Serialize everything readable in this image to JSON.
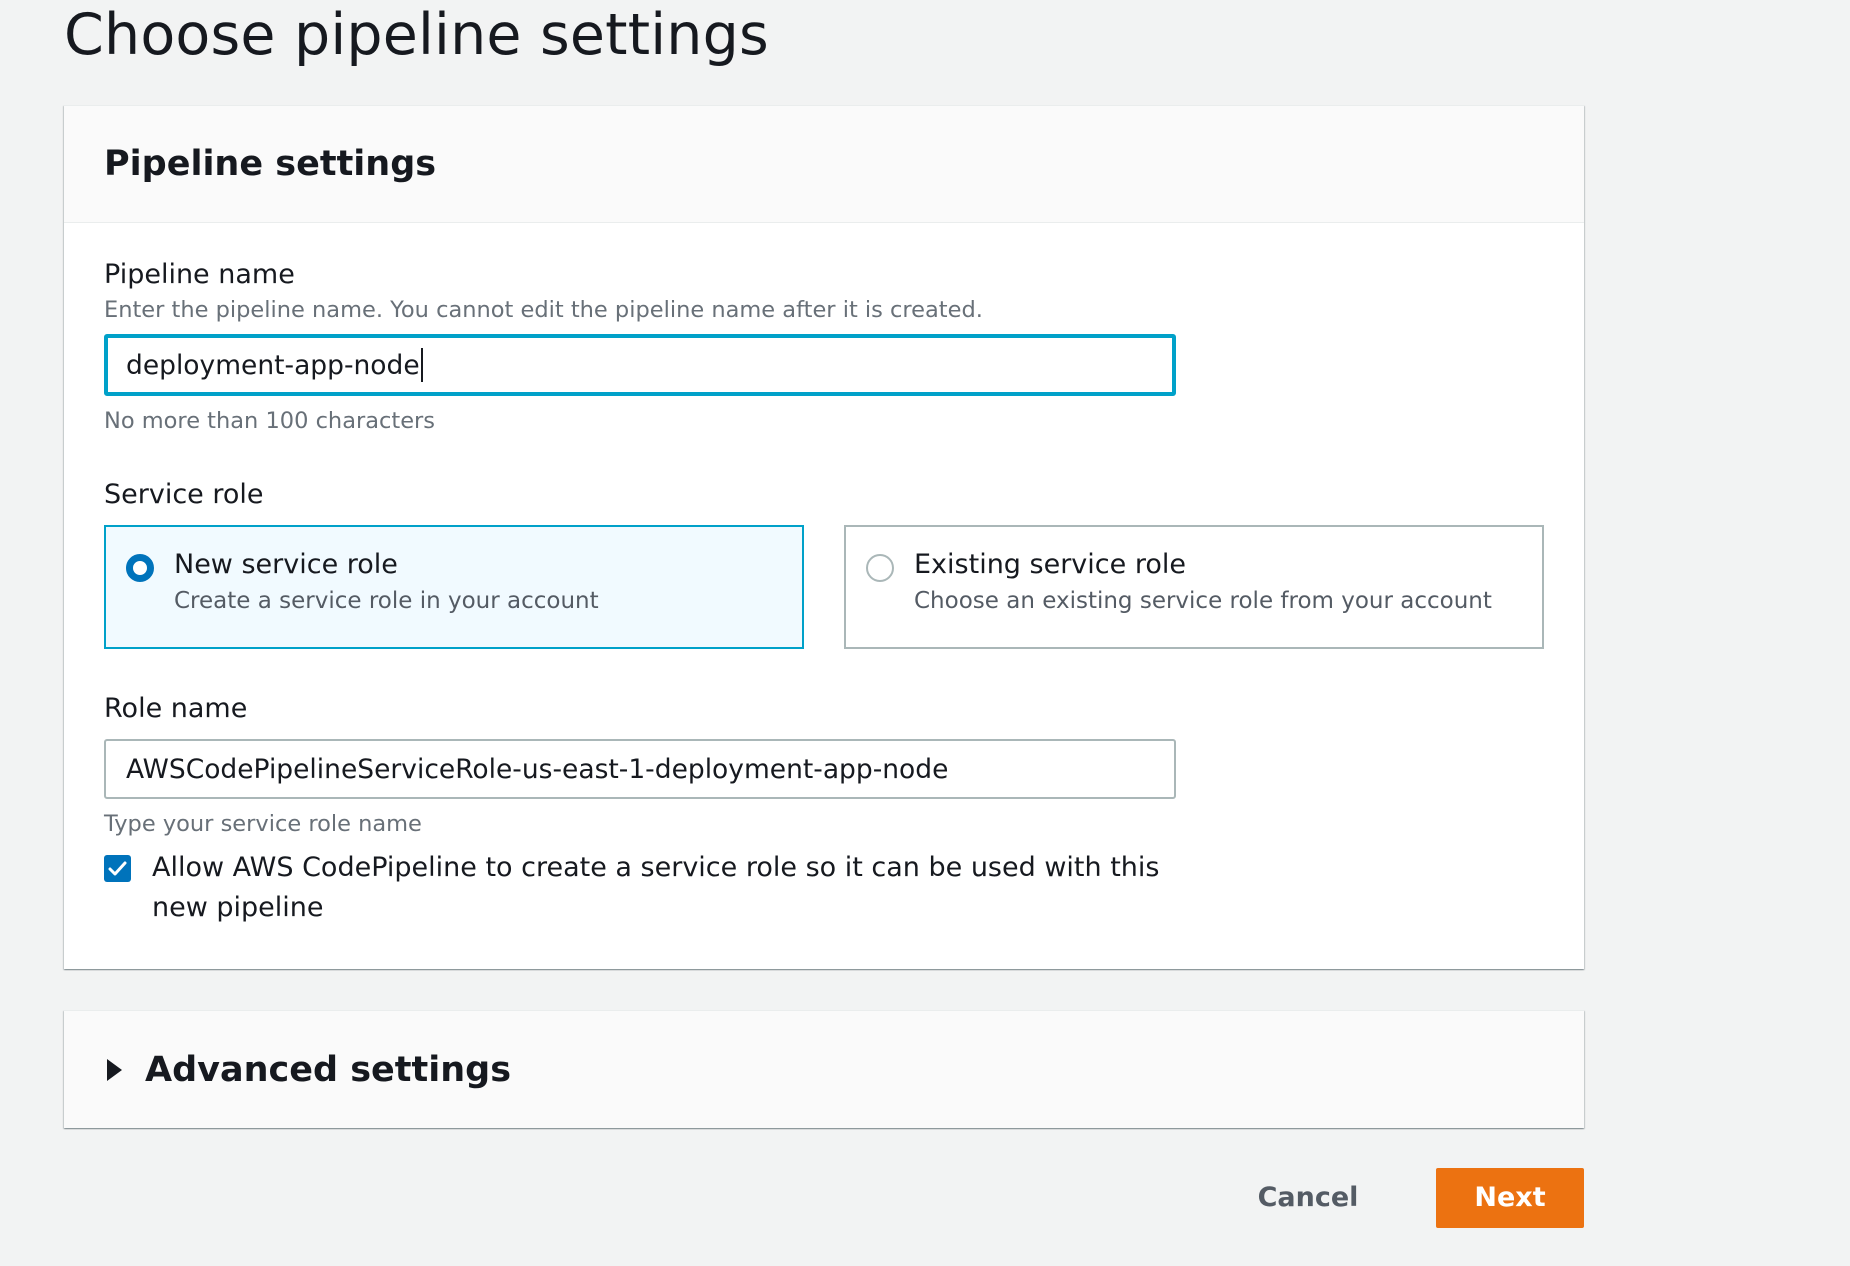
{
  "page": {
    "title": "Choose pipeline settings"
  },
  "pipeline_settings": {
    "header": "Pipeline settings",
    "pipeline_name": {
      "label": "Pipeline name",
      "description": "Enter the pipeline name. You cannot edit the pipeline name after it is created.",
      "value": "deployment-app-node",
      "constraint": "No more than 100 characters"
    },
    "service_role": {
      "label": "Service role",
      "options": [
        {
          "title": "New service role",
          "description": "Create a service role in your account",
          "selected": true
        },
        {
          "title": "Existing service role",
          "description": "Choose an existing service role from your account",
          "selected": false
        }
      ]
    },
    "role_name": {
      "label": "Role name",
      "value": "AWSCodePipelineServiceRole-us-east-1-deployment-app-node",
      "constraint": "Type your service role name"
    },
    "allow_create": {
      "checked": true,
      "label": "Allow AWS CodePipeline to create a service role so it can be used with this new pipeline"
    }
  },
  "advanced_settings": {
    "header": "Advanced settings"
  },
  "footer": {
    "cancel_label": "Cancel",
    "next_label": "Next"
  },
  "colors": {
    "accent": "#0073bb",
    "focus": "#00a1c9",
    "primary_button": "#ec7211",
    "background": "#f2f3f3"
  }
}
